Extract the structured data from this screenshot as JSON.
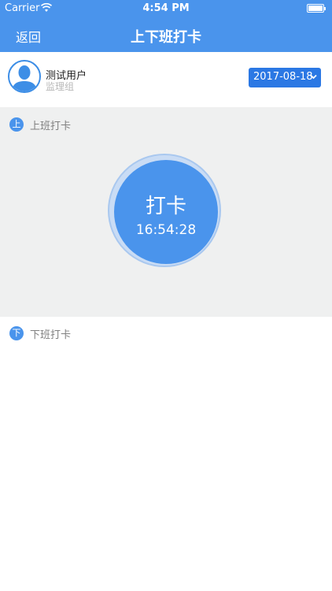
{
  "status_bar": {
    "carrier": "Carrier",
    "time": "4:54 PM"
  },
  "nav": {
    "back_label": "返回",
    "title": "上下班打卡"
  },
  "user": {
    "name": "测试用户",
    "group": "监理组"
  },
  "date_picker": {
    "value": "2017-08-18"
  },
  "on_duty": {
    "badge": "上",
    "label": "上班打卡"
  },
  "punch_button": {
    "label": "打卡",
    "time": "16:54:28"
  },
  "off_duty": {
    "badge": "下",
    "label": "下班打卡"
  },
  "colors": {
    "primary": "#4a94ec",
    "date_button": "#2b78e4",
    "section_bg": "#eff0f0"
  }
}
